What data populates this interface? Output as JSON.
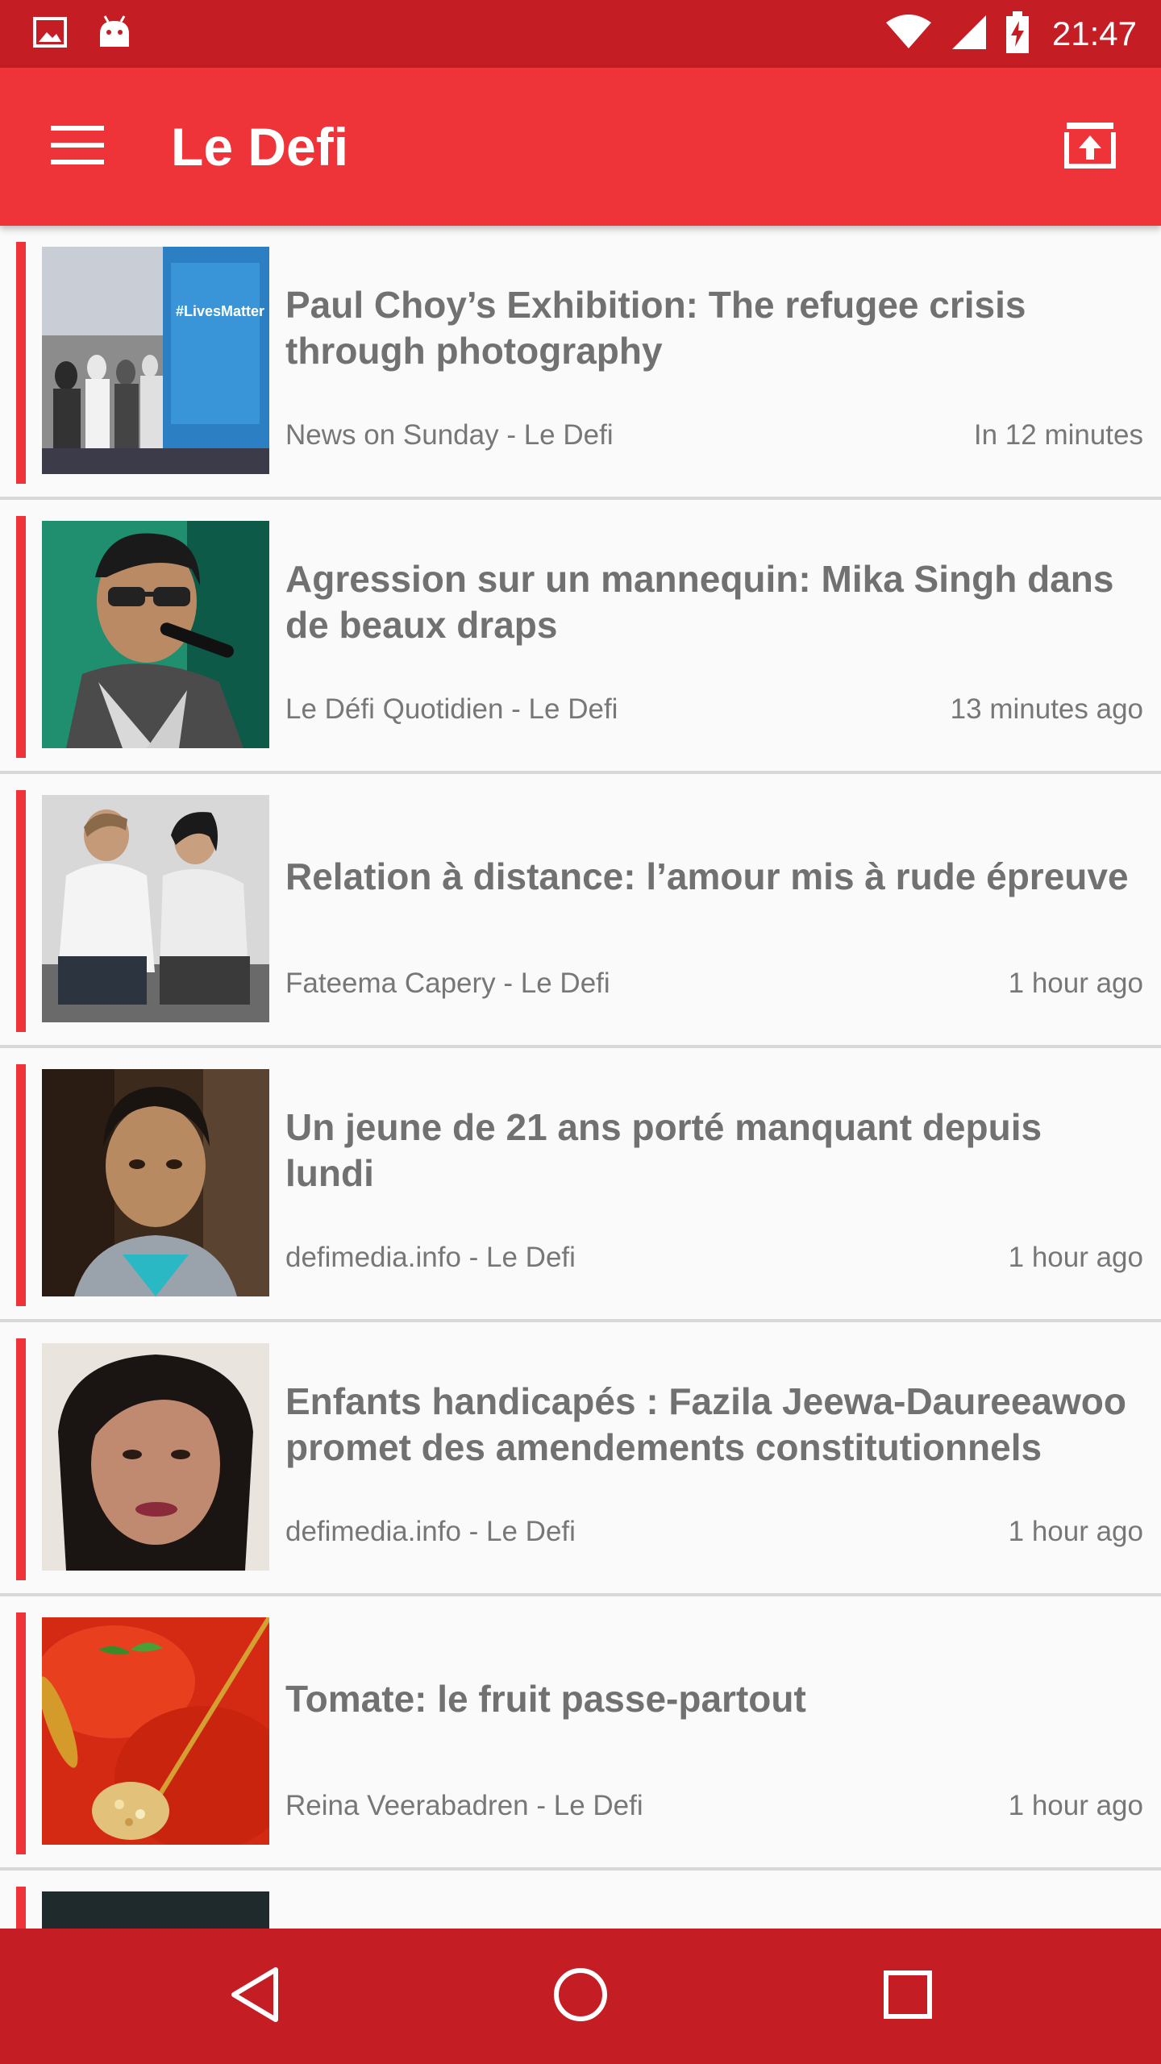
{
  "status_bar": {
    "time": "21:47",
    "icons": [
      "image-icon",
      "android-icon",
      "wifi-icon",
      "signal-icon",
      "battery-charging-icon"
    ]
  },
  "app_bar": {
    "title": "Le Defi",
    "menu_icon": "hamburger-menu-icon",
    "share_icon": "open-in-external-icon"
  },
  "colors": {
    "status_bar": "#c41e24",
    "app_bar": "#ef3439",
    "accent": "#ef3439",
    "title_text": "#717171",
    "meta_text": "#777777",
    "background": "#fafafa",
    "divider": "#d8d8d8"
  },
  "articles": [
    {
      "title": "Paul Choy’s Exhibition: The refugee crisis through photography",
      "source": "News on Sunday - Le Defi",
      "time": "In 12 minutes"
    },
    {
      "title": "Agression sur un mannequin: Mika Singh dans de beaux draps",
      "source": "Le Défi Quotidien - Le Defi",
      "time": "13 minutes ago"
    },
    {
      "title": "Relation à distance: l’amour mis à rude épreuve",
      "source": "Fateema Capery - Le Defi",
      "time": "1 hour ago"
    },
    {
      "title": "Un jeune de 21 ans porté manquant depuis lundi",
      "source": "defimedia.info - Le Defi",
      "time": "1 hour ago"
    },
    {
      "title": "Enfants handicapés : Fazila Jeewa-Daureeawoo promet des amendements constitutionnels",
      "source": "defimedia.info - Le Defi",
      "time": "1 hour ago"
    },
    {
      "title": "Tomate: le fruit passe-partout",
      "source": "Reina Veerabadren - Le Defi",
      "time": "1 hour ago"
    }
  ],
  "nav_bar": {
    "icons": [
      "back-icon",
      "home-icon",
      "recents-icon"
    ]
  }
}
